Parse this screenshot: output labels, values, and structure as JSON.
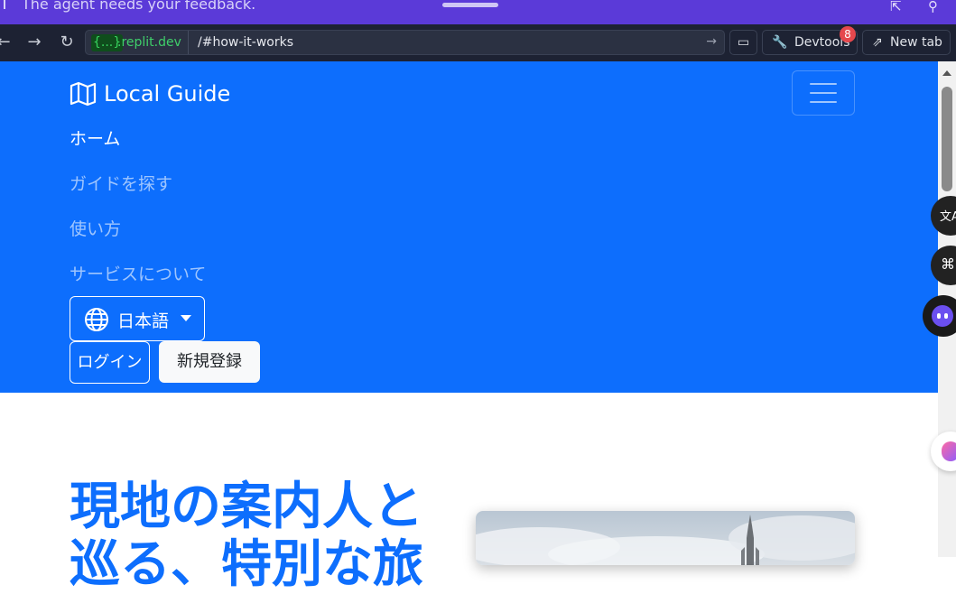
{
  "notice": {
    "text": "The agent needs your feedback."
  },
  "browser": {
    "domain_prefix": "{...}",
    "domain": ".replit.dev",
    "path": "/#how-it-works",
    "devtools_label": "Devtools",
    "devtools_badge": "8",
    "newtab_label": "New tab"
  },
  "nav": {
    "brand": "Local Guide",
    "links": [
      "ホーム",
      "ガイドを探す",
      "使い方",
      "サービスについて"
    ],
    "language": "日本語",
    "login": "ログイン",
    "signup": "新規登録"
  },
  "hero": {
    "title": "現地の案内人と巡る、特別な旅"
  },
  "colors": {
    "primary": "#0d6efd",
    "chrome": "#1d2233",
    "notice": "#5b3ad8"
  }
}
